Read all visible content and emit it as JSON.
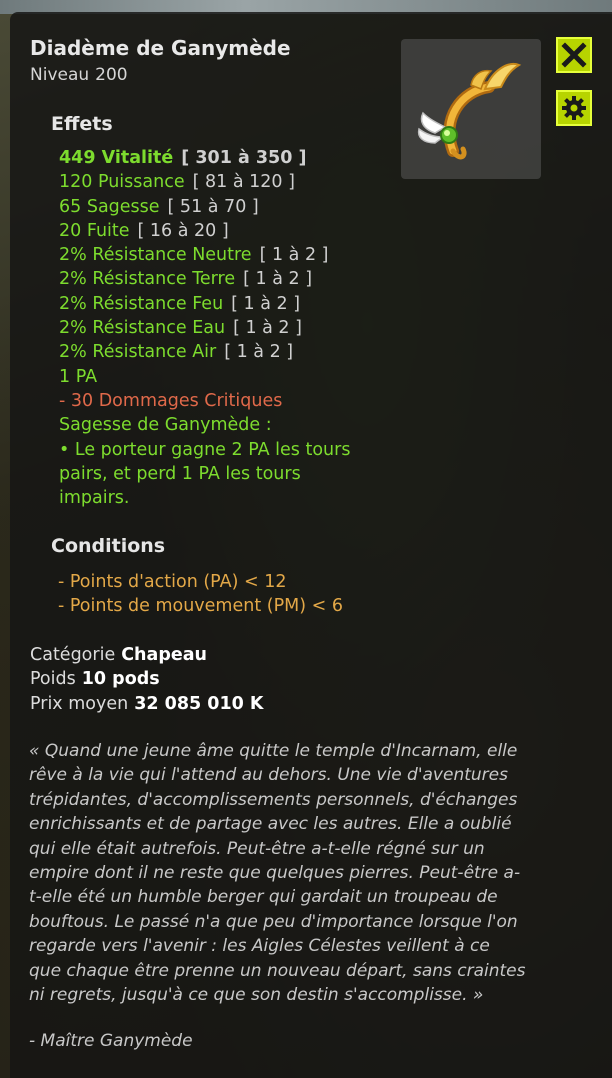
{
  "item": {
    "name": "Diadème de Ganymède",
    "level_label": "Niveau",
    "level_value": "200",
    "icon": "winged-golden-diadem-icon"
  },
  "buttons": {
    "close_icon": "close-icon",
    "settings_icon": "gear-icon"
  },
  "effects": {
    "title": "Effets",
    "lines": [
      {
        "text": "449 Vitalité",
        "range": "[ 301 à 350 ]"
      },
      {
        "text": "120 Puissance",
        "range": "[ 81 à 120 ]"
      },
      {
        "text": "65 Sagesse",
        "range": "[ 51 à 70 ]"
      },
      {
        "text": "20 Fuite",
        "range": "[ 16 à 20 ]"
      },
      {
        "text": "2% Résistance Neutre",
        "range": "[ 1 à 2 ]"
      },
      {
        "text": "2% Résistance Terre",
        "range": "[ 1 à 2 ]"
      },
      {
        "text": "2% Résistance Feu",
        "range": "[ 1 à 2 ]"
      },
      {
        "text": "2% Résistance Eau",
        "range": "[ 1 à 2 ]"
      },
      {
        "text": "2% Résistance Air",
        "range": "[ 1 à 2 ]"
      }
    ],
    "pa": "1 PA",
    "malus": "- 30 Dommages Critiques",
    "special_title": "Sagesse de Ganymède :",
    "special_lines": [
      "• Le porteur gagne 2 PA les tours",
      "pairs, et perd 1 PA les tours",
      "impairs."
    ]
  },
  "conditions": {
    "title": "Conditions",
    "lines": [
      "- Points d'action (PA) < 12",
      "- Points de mouvement (PM) < 6"
    ]
  },
  "meta": {
    "category_label": "Catégorie",
    "category_value": "Chapeau",
    "weight_label": "Poids",
    "weight_value": "10 pods",
    "price_label": "Prix moyen",
    "price_value": "32 085 010 K"
  },
  "description": {
    "lines": [
      "« Quand une jeune âme quitte le temple d'Incarnam, elle",
      "rêve à la vie qui l'attend au dehors. Une vie d'aventures",
      "trépidantes, d'accomplissements personnels, d'échanges",
      "enrichissants et de partage avec les autres. Elle a oublié",
      "qui elle était autrefois. Peut-être a-t-elle régné sur un",
      "empire dont il ne reste que quelques pierres. Peut-être a-",
      "t-elle été un humble berger qui gardait un troupeau de",
      "bouftous. Le passé n'a que peu d'importance lorsque l'on",
      "regarde vers l'avenir : les Aigles Célestes veillent à ce",
      "que chaque être prenne un nouveau départ, sans craintes",
      "ni regrets, jusqu'à ce que son destin s'accomplisse. »"
    ],
    "author": "- Maître Ganymède"
  },
  "colors": {
    "bonus": "#7ddc2e",
    "malus": "#e0694a",
    "condition": "#e3a848",
    "button": "#b7d400"
  }
}
